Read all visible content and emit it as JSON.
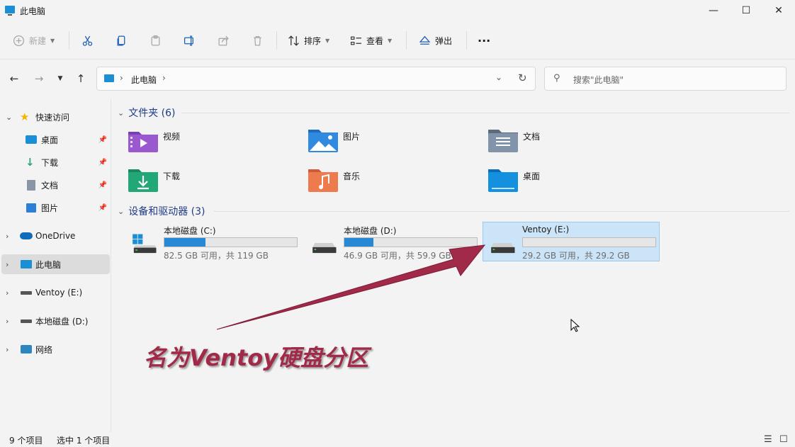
{
  "window": {
    "title": "此电脑",
    "minimize": "—",
    "maximize": "☐",
    "close": "✕"
  },
  "toolbar": {
    "new_label": "新建",
    "sort_label": "排序",
    "view_label": "查看",
    "eject_label": "弹出",
    "more_label": "···"
  },
  "address": {
    "crumb": "此电脑",
    "search_placeholder": "搜索\"此电脑\""
  },
  "sidebar": {
    "items": [
      {
        "label": "快速访问"
      },
      {
        "label": "桌面"
      },
      {
        "label": "下载"
      },
      {
        "label": "文档"
      },
      {
        "label": "图片"
      },
      {
        "label": "OneDrive"
      },
      {
        "label": "此电脑"
      },
      {
        "label": "Ventoy (E:)"
      },
      {
        "label": "本地磁盘 (D:)"
      },
      {
        "label": "网络"
      }
    ]
  },
  "folders_section": {
    "title": "文件夹 (6)",
    "items": [
      {
        "name": "视频"
      },
      {
        "name": "图片"
      },
      {
        "name": "文档"
      },
      {
        "name": "下载"
      },
      {
        "name": "音乐"
      },
      {
        "name": "桌面"
      }
    ]
  },
  "drives_section": {
    "title": "设备和驱动器 (3)",
    "items": [
      {
        "name": "本地磁盘 (C:)",
        "info": "82.5 GB 可用，共 119 GB",
        "used_fraction": 0.31
      },
      {
        "name": "本地磁盘 (D:)",
        "info": "46.9 GB 可用，共 59.9 GB",
        "used_fraction": 0.22
      },
      {
        "name": "Ventoy (E:)",
        "info": "29.2 GB 可用，共 29.2 GB",
        "used_fraction": 0.0
      }
    ]
  },
  "status": {
    "count": "9 个项目",
    "selected": "选中 1 个项目"
  },
  "annotation": {
    "text": "名为Ventoy硬盘分区"
  },
  "colors": {
    "accent": "#2789d6",
    "annotation": "#a12a48",
    "selection": "#cce4f7"
  }
}
